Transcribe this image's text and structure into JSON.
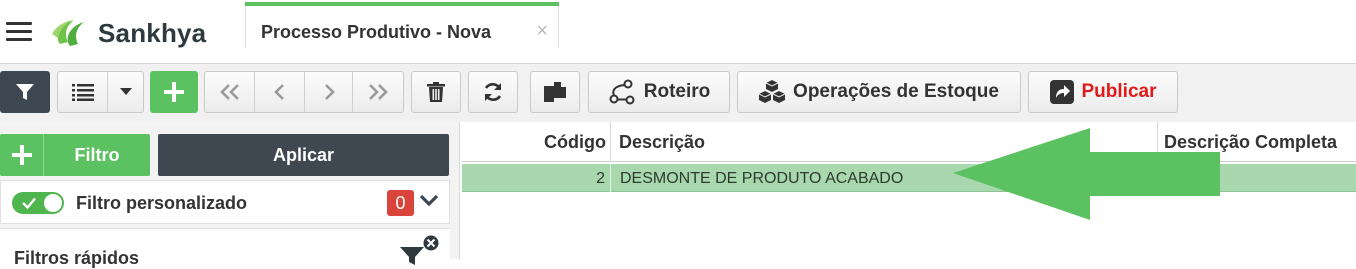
{
  "app": {
    "name": "Sankhya"
  },
  "tab": {
    "title": "Processo Produtivo - Nova",
    "close": "×"
  },
  "toolbar": {
    "roteiro_label": "Roteiro",
    "operacoes_label": "Operações de Estoque",
    "publicar_label": "Publicar",
    "publicar_color": "#e01b1b"
  },
  "filters": {
    "add_filter_label": "Filtro",
    "apply_label": "Aplicar",
    "custom_filter_label": "Filtro personalizado",
    "custom_filter_enabled": true,
    "custom_filter_count": "0",
    "quick_filters_label": "Filtros rápidos"
  },
  "grid": {
    "columns": [
      "Código",
      "Descrição",
      "Descrição Completa"
    ],
    "rows": [
      {
        "codigo": "2",
        "descricao": "DESMONTE DE PRODUTO ACABADO",
        "descricao_completa": ""
      }
    ]
  },
  "colors": {
    "accent_green": "#5cc160",
    "dark": "#3c4752",
    "badge_red": "#d9453a",
    "row_selected": "#a9d8ae"
  },
  "icons": [
    "menu-icon",
    "sankhya-logo-icon",
    "filter-icon",
    "list-icon",
    "caret-down-icon",
    "plus-icon",
    "first-icon",
    "previous-icon",
    "next-icon",
    "last-icon",
    "trash-icon",
    "refresh-icon",
    "copy-icon",
    "route-icon",
    "boxes-icon",
    "share-icon",
    "chevron-down-icon",
    "funnel-clear-icon",
    "arrow-annotation-icon"
  ]
}
